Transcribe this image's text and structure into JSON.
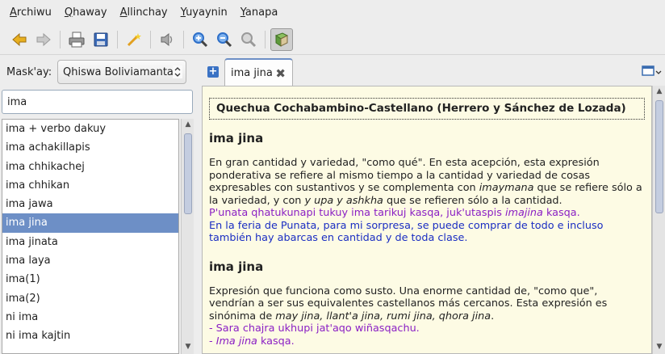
{
  "menu": {
    "items": [
      {
        "first": "A",
        "rest": "rchiwu"
      },
      {
        "first": "Q",
        "rest": "haway"
      },
      {
        "first": "A",
        "rest": "llinchay"
      },
      {
        "first": "Y",
        "rest": "uyaynin"
      },
      {
        "first": "Y",
        "rest": "anapa"
      }
    ]
  },
  "toolbar": {
    "icons": [
      "back-arrow-icon",
      "forward-arrow-icon",
      "print-icon",
      "save-icon",
      "magic-wand-icon",
      "speaker-icon",
      "zoom-in-icon",
      "zoom-out-icon",
      "zoom-reset-icon",
      "dictionary-book-icon"
    ],
    "colors": {
      "back": "#e8b020",
      "forward": "#b9b9b9",
      "zoom": "#2e6fc8",
      "book": "#5e9a3c"
    }
  },
  "left": {
    "dict_label": "Mask'ay:",
    "dict_value": "Qhiswa Boliviamanta",
    "search_value": "ima",
    "words": [
      "ima + verbo dakuy",
      "ima achakillapis",
      "ima chhikachej",
      "ima chhikan",
      "ima jawa",
      "ima jina",
      "ima jinata",
      "ima laya",
      "ima(1)",
      "ima(2)",
      "ni ima",
      "ni ima kajtin"
    ],
    "selected_index": 5
  },
  "tab": {
    "label": "ima jina"
  },
  "article": {
    "dict_title": "Quechua Cochabambino-Castellano (Herrero y Sánchez de Lozada)",
    "entry1": {
      "headword": "ima jina",
      "p1": "En gran cantidad y variedad, \"como qué\". En esta acepción, esta expresión ponderativa se refiere al mismo tiempo a la cantidad y variedad de cosas expresables con sustantivos y se complementa con ",
      "p1_em1": "imaymana",
      "p1_mid": " que se refiere sólo a la variedad, y con ",
      "p1_em2": "y upa y ashkha",
      "p1_end": " que se refieren sólo a la cantidad.",
      "ex_q_a": "P'unata qhatukunapi tukuy ima tarikuj kasqa, juk'utaspis ",
      "ex_q_em": "imajina",
      "ex_q_b": " kasqa.",
      "ex_s": "En la feria de Punata, para mi sorpresa, se puede comprar de todo e incluso también hay abarcas en cantidad y de toda clase."
    },
    "entry2": {
      "headword": "ima jina",
      "p1": "Expresión que funciona como susto. Una enorme cantidad de, \"como que\", vendrían a ser sus equivalentes castellanos más cercanos. Esta expresión es sinónima de ",
      "p1_em": "may jina, llant'a jina, rumi jina, qhora jina",
      "p1_end": ".",
      "ex1": "- Sara chajra ukhupi jat'aqo wiñasqachu.",
      "ex2_pre": "- ",
      "ex2_em": "Ima jina",
      "ex2_post": " kasqa."
    }
  }
}
